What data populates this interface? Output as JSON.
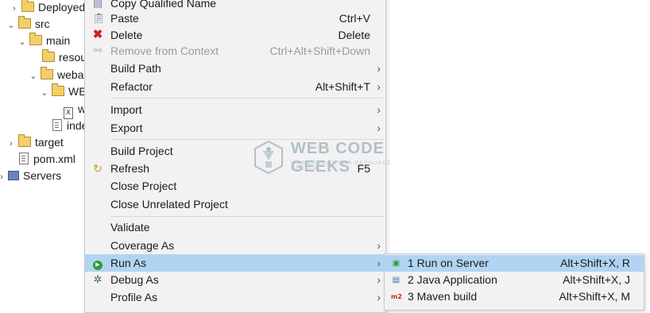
{
  "tree": [
    {
      "label": "Deployed R",
      "twisty": "›",
      "icon": "deployed-resources-icon"
    },
    {
      "label": "src",
      "twisty": "⌄",
      "icon": "folder-icon"
    },
    {
      "label": "main",
      "twisty": "⌄",
      "icon": "folder-icon"
    },
    {
      "label": "resour",
      "twisty": "",
      "icon": "folder-icon"
    },
    {
      "label": "webap",
      "twisty": "⌄",
      "icon": "folder-icon"
    },
    {
      "label": "WEB",
      "twisty": "⌄",
      "icon": "folder-icon"
    },
    {
      "label": "w",
      "twisty": "",
      "icon": "xml-file-icon"
    },
    {
      "label": "inde",
      "twisty": "",
      "icon": "file-icon"
    },
    {
      "label": "target",
      "twisty": "›",
      "icon": "folder-icon"
    },
    {
      "label": "pom.xml",
      "twisty": "",
      "icon": "file-icon"
    },
    {
      "label": "Servers",
      "twisty": "›",
      "icon": "servers-icon"
    }
  ],
  "menu": {
    "items": [
      {
        "label": "Copy Qualified Name",
        "shortcut": "",
        "icon": "copy-icon"
      },
      {
        "label": "Paste",
        "shortcut": "Ctrl+V",
        "icon": "paste-icon"
      },
      {
        "label": "Delete",
        "shortcut": "Delete",
        "icon": "delete-icon"
      },
      {
        "label": "Remove from Context",
        "shortcut": "Ctrl+Alt+Shift+Down",
        "icon": "remove-context-icon",
        "disabled": true
      },
      {
        "label": "Build Path",
        "shortcut": "",
        "submenu": true
      },
      {
        "label": "Refactor",
        "shortcut": "Alt+Shift+T",
        "submenu": true
      },
      {
        "label": "Import",
        "shortcut": "",
        "submenu": true
      },
      {
        "label": "Export",
        "shortcut": "",
        "submenu": true
      },
      {
        "label": "Build Project",
        "shortcut": ""
      },
      {
        "label": "Refresh",
        "shortcut": "F5",
        "icon": "refresh-icon"
      },
      {
        "label": "Close Project",
        "shortcut": ""
      },
      {
        "label": "Close Unrelated Project",
        "shortcut": ""
      },
      {
        "label": "Validate",
        "shortcut": ""
      },
      {
        "label": "Coverage As",
        "shortcut": "",
        "submenu": true
      },
      {
        "label": "Run As",
        "shortcut": "",
        "submenu": true,
        "icon": "run-icon",
        "selected": true
      },
      {
        "label": "Debug As",
        "shortcut": "",
        "submenu": true,
        "icon": "debug-icon"
      },
      {
        "label": "Profile As",
        "shortcut": "",
        "submenu": true
      }
    ],
    "arrow": "›"
  },
  "submenu": {
    "items": [
      {
        "label": "1 Run on Server",
        "shortcut": "Alt+Shift+X, R",
        "icon": "server-run-icon",
        "selected": true
      },
      {
        "label": "2 Java Application",
        "shortcut": "Alt+Shift+X, J",
        "icon": "java-app-icon"
      },
      {
        "label": "3 Maven build",
        "shortcut": "Alt+Shift+X, M",
        "icon": "maven-icon",
        "icon_text": "m2"
      }
    ]
  },
  "watermark": {
    "title": "WEB CODE GEEKS",
    "subtitle": "WEB DEVELOPERS RESOURCE CENTER"
  }
}
